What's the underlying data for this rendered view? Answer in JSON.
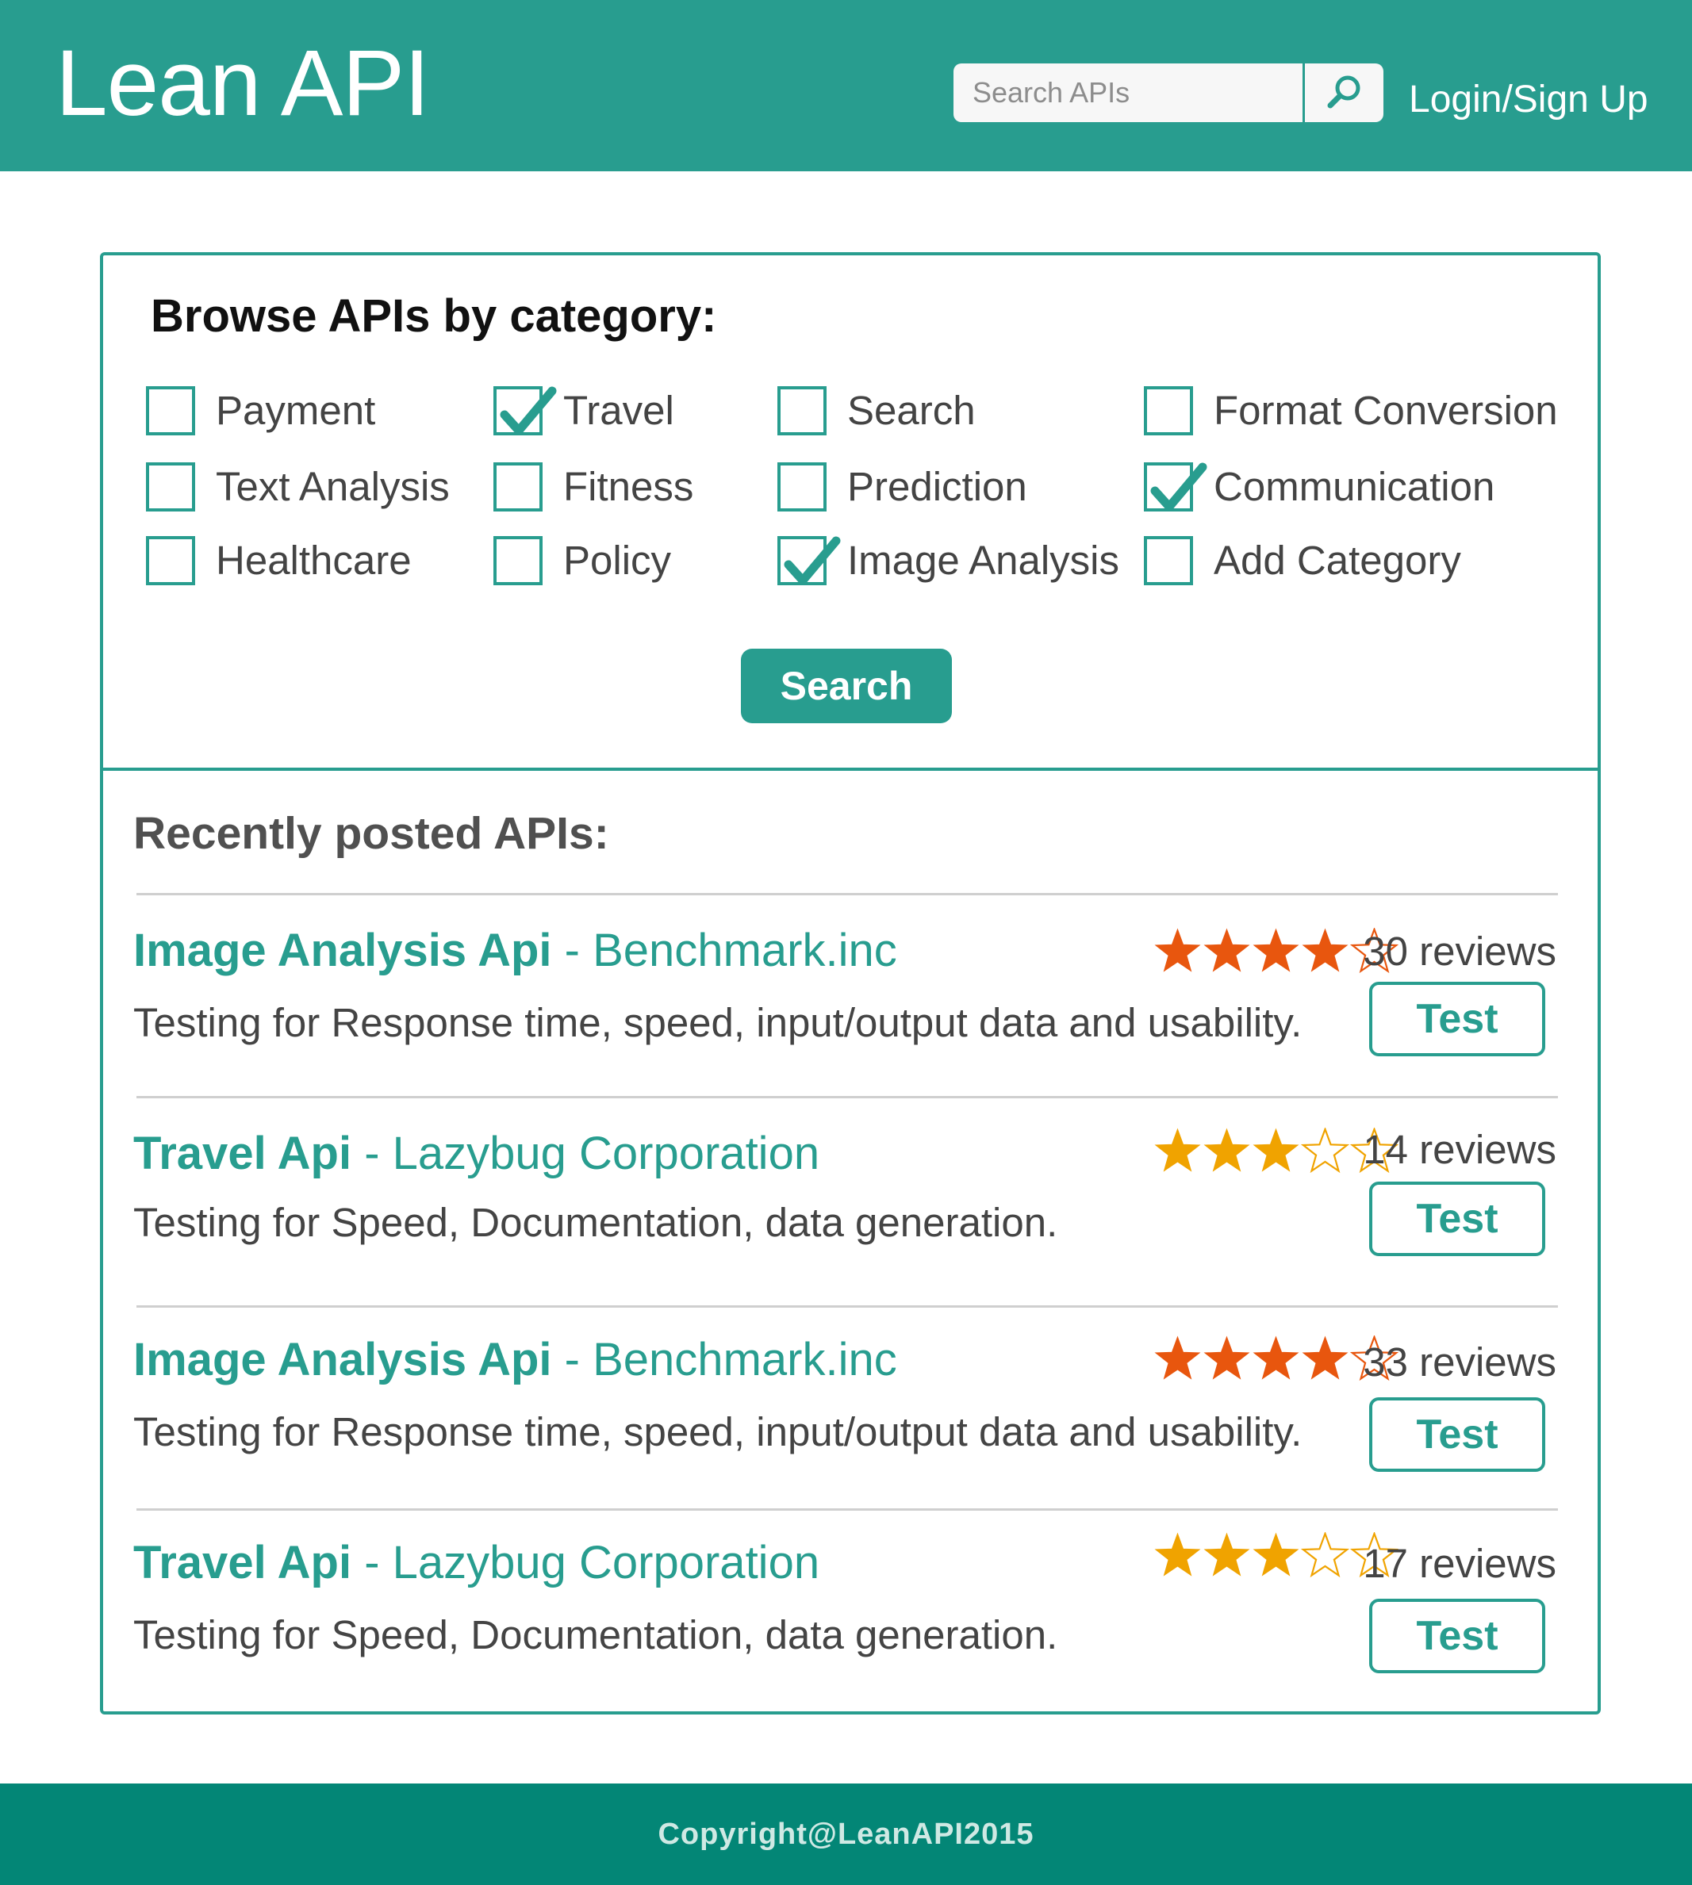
{
  "header": {
    "logo": "Lean API",
    "search_placeholder": "Search APIs",
    "login_label": "Login/Sign Up"
  },
  "browse": {
    "title": "Browse APIs by category:",
    "categories": [
      {
        "label": "Payment",
        "checked": false
      },
      {
        "label": "Travel",
        "checked": true
      },
      {
        "label": "Search",
        "checked": false
      },
      {
        "label": "Format Conversion",
        "checked": false
      },
      {
        "label": "Text Analysis",
        "checked": false
      },
      {
        "label": "Fitness",
        "checked": false
      },
      {
        "label": "Prediction",
        "checked": false
      },
      {
        "label": "Communication",
        "checked": true
      },
      {
        "label": "Healthcare",
        "checked": false
      },
      {
        "label": "Policy",
        "checked": false
      },
      {
        "label": "Image Analysis",
        "checked": true
      },
      {
        "label": "Add Category",
        "checked": false
      }
    ],
    "search_button": "Search"
  },
  "recent": {
    "title": "Recently posted APIs:",
    "items": [
      {
        "name": "Image Analysis Api",
        "sep": " - ",
        "company": "Benchmark.inc",
        "description": "Testing for Response time, speed, input/output data and usability.",
        "rating": 4,
        "max_rating": 5,
        "star_color": "#e8560e",
        "reviews": "30 reviews",
        "button": "Test"
      },
      {
        "name": "Travel Api",
        "sep": " - ",
        "company": "Lazybug Corporation",
        "description": "Testing for Speed, Documentation, data generation.",
        "rating": 3,
        "max_rating": 5,
        "star_color": "#f0a300",
        "reviews": "14 reviews",
        "button": "Test"
      },
      {
        "name": "Image Analysis Api",
        "sep": " - ",
        "company": "Benchmark.inc",
        "description": "Testing for Response time, speed, input/output data and usability.",
        "rating": 4,
        "max_rating": 5,
        "star_color": "#e8560e",
        "reviews": "33 reviews",
        "button": "Test"
      },
      {
        "name": "Travel Api",
        "sep": " - ",
        "company": "Lazybug Corporation",
        "description": "Testing for Speed, Documentation, data generation.",
        "rating": 3,
        "max_rating": 5,
        "star_color": "#f0a300",
        "reviews": "17 reviews",
        "button": "Test"
      }
    ]
  },
  "footer": {
    "copyright": "Copyright@LeanAPI2015"
  },
  "colors": {
    "brand": "#289d8f",
    "footer": "#038676"
  }
}
